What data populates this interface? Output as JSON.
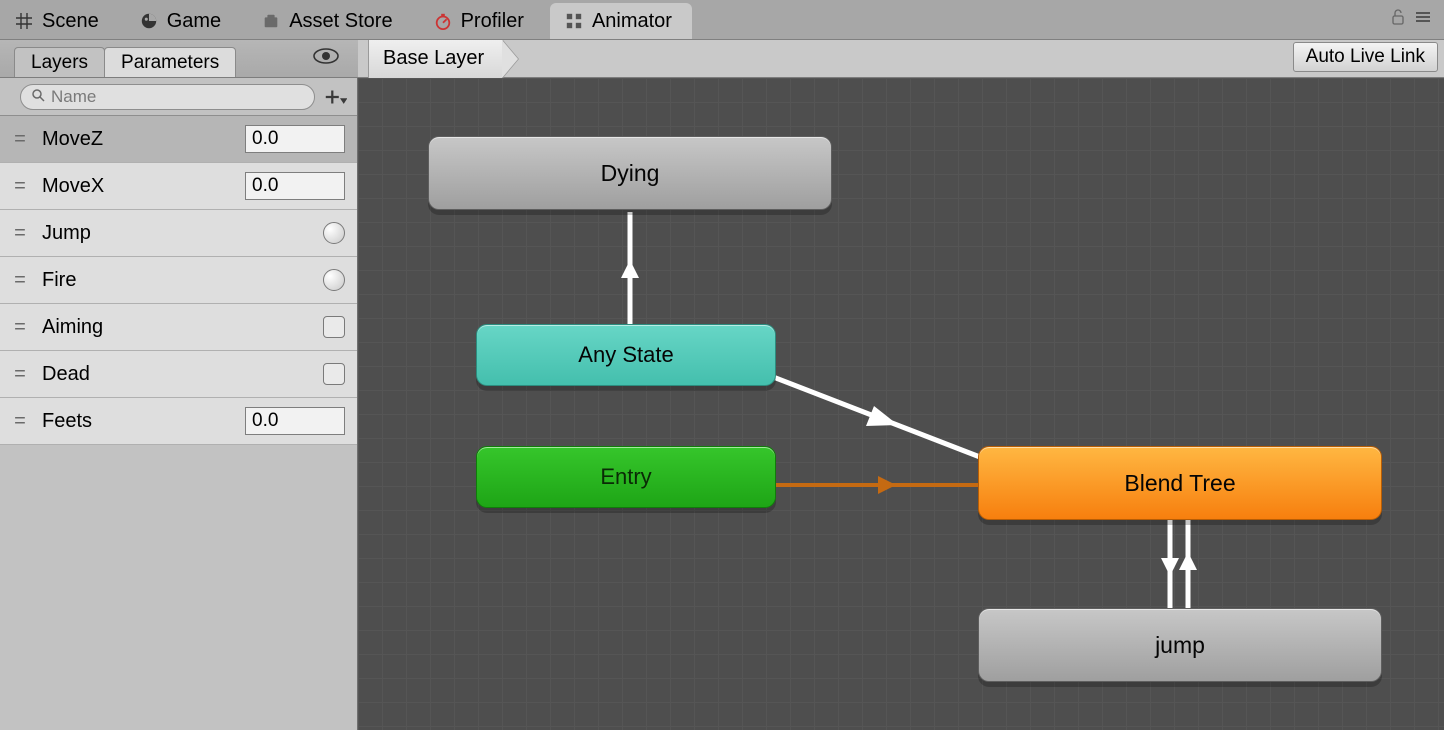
{
  "tabs": {
    "scene": "Scene",
    "game": "Game",
    "asset_store": "Asset Store",
    "profiler": "Profiler",
    "animator": "Animator"
  },
  "subtabs": {
    "layers": "Layers",
    "parameters": "Parameters"
  },
  "breadcrumb": {
    "base_layer": "Base Layer"
  },
  "buttons": {
    "auto_live_link": "Auto Live Link"
  },
  "search": {
    "placeholder": "Name"
  },
  "parameters": [
    {
      "name": "MoveZ",
      "type": "float",
      "value": "0.0",
      "selected": true
    },
    {
      "name": "MoveX",
      "type": "float",
      "value": "0.0",
      "selected": false
    },
    {
      "name": "Jump",
      "type": "trigger",
      "value": "",
      "selected": false
    },
    {
      "name": "Fire",
      "type": "trigger",
      "value": "",
      "selected": false
    },
    {
      "name": "Aiming",
      "type": "bool",
      "value": "",
      "selected": false
    },
    {
      "name": "Dead",
      "type": "bool",
      "value": "",
      "selected": false
    },
    {
      "name": "Feets",
      "type": "float",
      "value": "0.0",
      "selected": false
    }
  ],
  "nodes": {
    "dying": {
      "label": "Dying"
    },
    "any_state": {
      "label": "Any State"
    },
    "entry": {
      "label": "Entry"
    },
    "blend_tree": {
      "label": "Blend Tree"
    },
    "jump": {
      "label": "jump"
    }
  },
  "chart_data": {
    "type": "state_machine",
    "nodes": [
      {
        "id": "dying",
        "label": "Dying",
        "kind": "state"
      },
      {
        "id": "any_state",
        "label": "Any State",
        "kind": "special_any"
      },
      {
        "id": "entry",
        "label": "Entry",
        "kind": "special_entry"
      },
      {
        "id": "blend_tree",
        "label": "Blend Tree",
        "kind": "default_state"
      },
      {
        "id": "jump",
        "label": "jump",
        "kind": "state"
      }
    ],
    "transitions": [
      {
        "from": "any_state",
        "to": "dying",
        "color": "white"
      },
      {
        "from": "any_state",
        "to": "blend_tree",
        "color": "white"
      },
      {
        "from": "entry",
        "to": "blend_tree",
        "color": "orange"
      },
      {
        "from": "blend_tree",
        "to": "jump",
        "color": "white"
      },
      {
        "from": "jump",
        "to": "blend_tree",
        "color": "white"
      }
    ]
  }
}
